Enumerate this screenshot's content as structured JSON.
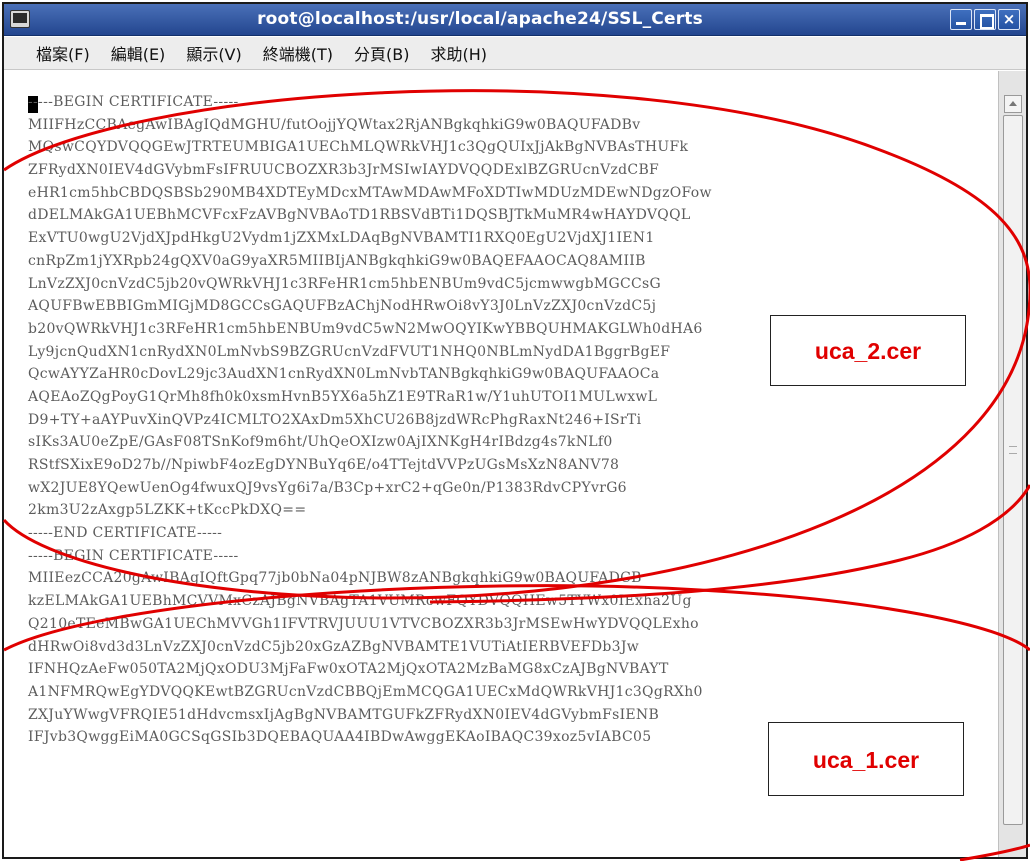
{
  "window": {
    "title": "root@localhost:/usr/local/apache24/SSL_Certs",
    "controls": {
      "minimize": "",
      "maximize": "",
      "close": "×"
    }
  },
  "menu": [
    "檔案(F)",
    "編輯(E)",
    "顯示(V)",
    "終端機(T)",
    "分頁(B)",
    "求助(H)"
  ],
  "terminal": {
    "lines": [
      "-----BEGIN CERTIFICATE-----",
      "MIIFHzCCBAegAwIBAgIQdMGHU/futOojjYQWtax2RjANBgkqhkiG9w0BAQUFADBv",
      "MQswCQYDVQQGEwJTRTEUMBIGA1UEChMLQWRkVHJ1c3QgQUIxJjAkBgNVBAsTHUFk",
      "ZFRydXN0IEV4dGVybmFsIFRUUCBOZXR3b3JrMSIwIAYDVQQDExlBZGRUcnVzdCBF",
      "eHR1cm5hbCBDQSBSb290MB4XDTEyMDcxMTAwMDAwMFoXDTIwMDUzMDEwNDgzOFow",
      "dDELMAkGA1UEBhMCVFcxFzAVBgNVBAoTD1RBSVdBTi1DQSBJTkMuMR4wHAYDVQQL",
      "ExVTU0wgU2VjdXJpdHkgU2Vydm1jZXMxLDAqBgNVBAMTI1RXQ0EgU2VjdXJ1IEN1",
      "cnRpZm1jYXRpb24gQXV0aG9yaXR5MIIBIjANBgkqhkiG9w0BAQEFAAOCAQ8AMIIB",
      "LnVzZXJ0cnVzdC5jb20vQWRkVHJ1c3RFeHR1cm5hbENBUm9vdC5jcmwwgbMGCCsG",
      "AQUFBwEBBIGmMIGjMD8GCCsGAQUFBzAChjNodHRwOi8vY3J0LnVzZXJ0cnVzdC5j",
      "b20vQWRkVHJ1c3RFeHR1cm5hbENBUm9vdC5wN2MwOQYIKwYBBQUHMAKGLWh0dHA6",
      "Ly9jcnQudXN1cnRydXN0LmNvbS9BZGRUcnVzdFVUT1NHQ0NBLmNydDA1BggrBgEF",
      "QcwAYYZaHR0cDovL29jc3AudXN1cnRydXN0LmNvbTANBgkqhkiG9w0BAQUFAAOCa",
      "AQEAoZQgPoyG1QrMh8fh0k0xsmHvnB5YX6a5hZ1E9TRaR1w/Y1uhUTOI1MULwxwL",
      "D9+TY+aAYPuvXinQVPz4ICMLTO2XAxDm5XhCU26B8jzdWRcPhgRaxNt246+ISrTi",
      "sIKs3AU0eZpE/GAsF08TSnKof9m6ht/UhQeOXIzw0AjIXNKgH4rIBdzg4s7kNLf0",
      "RStfSXixE9oD27b//NpiwbF4ozEgDYNBuYq6E/o4TTejtdVVPzUGsMsXzN8ANV78",
      "wX2JUE8YQewUenOg4fwuxQJ9vsYg6i7a/B3Cp+xrC2+qGe0n/P1383RdvCPYvrG6",
      "2km3U2zAxgp5LZKK+tKccPkDXQ==",
      "-----END CERTIFICATE-----",
      "-----BEGIN CERTIFICATE-----",
      "MIIEezCCA20gAwIBAgIQftGpq77jb0bNa04pNJBW8zANBgkqhkiG9w0BAQUFADCB",
      "kzELMAkGA1UEBhMCVVMxCzAJBgNVBAgTA1VUMRcwFQYDVQQHEw5TYWx0IExha2Ug",
      "Q210eTEeMBwGA1UEChMVVGh1IFVTRVJUUU1VTVCBOZXR3b3JrMSEwHwYDVQQLExho",
      "dHRwOi8vd3d3LnVzZXJ0cnVzdC5jb20xGzAZBgNVBAMTE1VUTiAtIERBVEFDb3Jw",
      "IFNHQzAeFw050TA2MjQxODU3MjFaFw0xOTA2MjQxOTA2MzBaMG8xCzAJBgNVBAYT",
      "A1NFMRQwEgYDVQQKEwtBZGRUcnVzdCBBQjEmMCQGA1UECxMdQWRkVHJ1c3QgRXh0",
      "ZXJuYWwgVFRQIE51dHdvcmsxIjAgBgNVBAMTGUFkZFRydXN0IEV4dGVybmFsIENB",
      "IFJvb3QwggEiMA0GCSqGSIb3DQEBAQUAA4IBDwAwggEKAoIBAQC39xoz5vIABC05"
    ]
  },
  "callouts": {
    "upper": "uca_2.cer",
    "lower": "uca_1.cer"
  },
  "annotation_color": "#e00000"
}
